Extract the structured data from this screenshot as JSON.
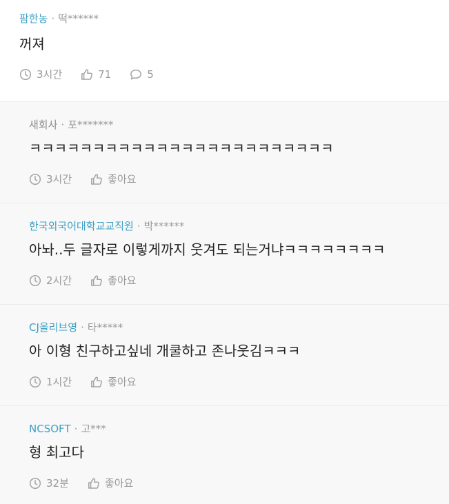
{
  "comment": {
    "company": "팜한농",
    "company_color": "#3d9fc4",
    "separator": "·",
    "author": "떡******",
    "body": "꺼져",
    "time": "3시간",
    "likes": "71",
    "reply_count": "5"
  },
  "replies": [
    {
      "company": "새회사",
      "company_color": "#8c8c8c",
      "separator": "·",
      "author": "포*******",
      "body": "ㅋㅋㅋㅋㅋㅋㅋㅋㅋㅋㅋㅋㅋㅋㅋㅋㅋㅋㅋㅋㅋㅋㅋㅋ",
      "time": "3시간",
      "like_label": "좋아요"
    },
    {
      "company": "한국외국어대학교교직원",
      "company_color": "#3d9fc4",
      "separator": "·",
      "author": "박******",
      "body": "아놔..두 글자로 이렇게까지 웃겨도 되는거냐ㅋㅋㅋㅋㅋㅋㅋㅋ",
      "time": "2시간",
      "like_label": "좋아요"
    },
    {
      "company": "CJ올리브영",
      "company_color": "#3d9fc4",
      "separator": "·",
      "author": "타*****",
      "body": "아 이형 친구하고싶네 개쿨하고 존나웃김ㅋㅋㅋ",
      "time": "1시간",
      "like_label": "좋아요"
    },
    {
      "company": "NCSOFT",
      "company_color": "#3d9fc4",
      "separator": "·",
      "author": "고***",
      "body": "형 최고다",
      "time": "32분",
      "like_label": "좋아요"
    }
  ],
  "icons": {
    "time": "clock-icon",
    "like": "thumbs-up-icon",
    "reply": "comment-icon"
  },
  "colors": {
    "accent": "#3d9fc4",
    "text": "#222222",
    "muted": "#999999",
    "reply_background": "#f8f8f8",
    "divider": "#ebebeb"
  }
}
